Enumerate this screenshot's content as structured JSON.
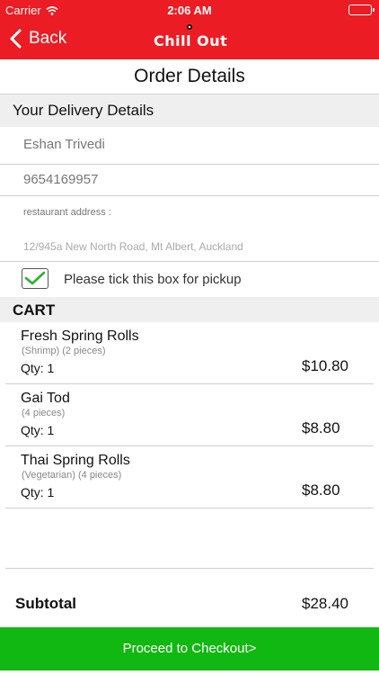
{
  "status_bar": {
    "carrier": "Carrier",
    "time": "2:06 AM"
  },
  "nav": {
    "back_label": "Back",
    "logo_text": "Chill Out"
  },
  "page_title": "Order Details",
  "delivery": {
    "heading": "Your Delivery Details",
    "name": "Eshan Trivedi",
    "phone": "9654169957",
    "address_label": "restaurant address :",
    "address_placeholder": "12/945a New North Road, Mt Albert, Auckland"
  },
  "pickup": {
    "label": "Please tick this box for pickup",
    "checked": true
  },
  "cart": {
    "heading": "CART",
    "items": [
      {
        "name": "Fresh Spring Rolls",
        "desc": "(Shrimp) (2 pieces)",
        "qty": "Qty: 1",
        "price": "$10.80"
      },
      {
        "name": "Gai Tod",
        "desc": "(4 pieces)",
        "qty": "Qty: 1",
        "price": "$8.80"
      },
      {
        "name": "Thai Spring Rolls",
        "desc": "(Vegetarian) (4 pieces)",
        "qty": "Qty: 1",
        "price": "$8.80"
      }
    ]
  },
  "subtotal": {
    "label": "Subtotal",
    "value": "$28.40"
  },
  "checkout_label": "Proceed to Checkout>",
  "colors": {
    "brand_red": "#ec1c24",
    "checkout_green": "#12b812",
    "check_green": "#2bb32b"
  }
}
